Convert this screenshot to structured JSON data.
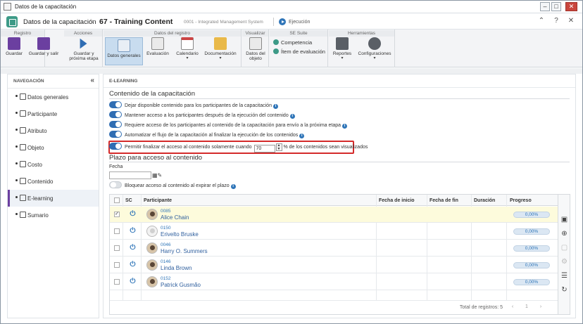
{
  "window": {
    "title": "Datos de la capacitación",
    "btn_min": "–",
    "btn_max": "□",
    "btn_close": "✕"
  },
  "header": {
    "module": "Datos de la capacitación",
    "separator": "›",
    "title": "67 - Training Content",
    "system": "0001 - Integrated Management System",
    "state": "Ejecución",
    "icons": [
      "chevrons-up-icon",
      "help-icon",
      "close-icon"
    ],
    "icon_glyphs": [
      "⌃",
      "?",
      "✕"
    ]
  },
  "ribbon": {
    "groups": [
      {
        "label": "Registro"
      },
      {
        "label": "Acciones"
      },
      {
        "label": "Datos del registro"
      },
      {
        "label": "Visualizar"
      },
      {
        "label": "SE Suite"
      },
      {
        "label": "Herramientas"
      }
    ],
    "buttons": {
      "guardar": "Guardar",
      "guardar_salir": "Guardar y salir",
      "guardar_proxima": "Guardar y próxima etapa",
      "datos_generales": "Datos generales",
      "evaluacion": "Evaluación",
      "calendario": "Calendario",
      "documentacion": "Documentación",
      "datos_objeto": "Datos del objeto",
      "reportes": "Reportes",
      "configuraciones": "Configuraciones",
      "dropdown": "▾"
    },
    "se_suite": [
      "Competencia",
      "Ítem de evaluación"
    ],
    "colors": {
      "accent": "#2f6db3",
      "green": "#3c9a87",
      "purple": "#6b3fa0"
    }
  },
  "nav": {
    "title": "NAVEGACIÓN",
    "collapse": "«",
    "items": [
      "Datos generales",
      "Participante",
      "Atributo",
      "Objeto",
      "Costo",
      "Contenido",
      "E-learning",
      "Sumario"
    ],
    "active": "E-learning"
  },
  "main": {
    "section_label": "E-LEARNING",
    "content_title": "Contenido de la capacitación",
    "options": [
      "Dejar disponible contenido para los participantes de la capacitación",
      "Mantener acceso a los participantes después de la ejecución del contenido",
      "Requiere acceso de los participantes al contenido de la capacitación para envío a la próxima etapa",
      "Automatizar el flujo de la capacitación al finalizar la ejecución de los contenidos"
    ],
    "finish_option": {
      "before": "Permitir finalizar el acceso al contenido solamente cuando",
      "value": "70",
      "after": "% de los contenidos sean visualizados"
    },
    "deadline_title": "Plazo para acceso al contenido",
    "date_label": "Fecha",
    "date_value": "",
    "block_label": "Bloquear acceso al contenido al expirar el plazo",
    "info_glyph": "i",
    "table": {
      "headers": [
        "SC",
        "Participante",
        "Fecha de inicio",
        "Fecha de fin",
        "Duración",
        "Progreso"
      ],
      "rows": [
        {
          "id": "0085",
          "name": "Alice Chain",
          "progress": "0,00%",
          "selected": true,
          "check": "✓",
          "power": "⏻"
        },
        {
          "id": "0150",
          "name": "Erivelto Bruske",
          "progress": "0,00%",
          "selected": false,
          "check": "",
          "power": "⏻"
        },
        {
          "id": "0046",
          "name": "Harry O. Summers",
          "progress": "0,00%",
          "selected": false,
          "check": "",
          "power": "⏻"
        },
        {
          "id": "0146",
          "name": "Linda Brown",
          "progress": "0,00%",
          "selected": false,
          "check": "",
          "power": "⏻"
        },
        {
          "id": "0152",
          "name": "Patrick Gusmão",
          "progress": "0,00%",
          "selected": false,
          "check": "",
          "power": "⏻"
        }
      ],
      "total": "Total de registros: 5",
      "page": "1",
      "pager": {
        "prev": "‹",
        "next": "›"
      }
    },
    "side_icons": [
      "video-icon",
      "add-record-icon",
      "edit-record-icon",
      "settings-icon",
      "list-icon",
      "refresh-icon"
    ],
    "side_glyphs": [
      "▣",
      "⊕",
      "▢",
      "⚙",
      "☰",
      "↻"
    ]
  }
}
